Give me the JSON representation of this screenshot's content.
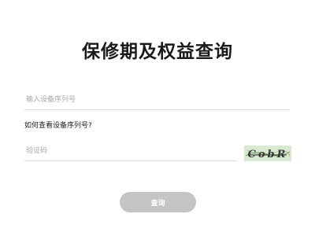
{
  "page": {
    "title": "保修期及权益查询"
  },
  "form": {
    "serial_placeholder": "输入设备序列号",
    "serial_value": "",
    "help_link": "如何查看设备序列号?",
    "code_placeholder": "验证码",
    "code_value": "",
    "captcha_text": "CobR",
    "submit_label": "查询"
  },
  "colors": {
    "button_bg": "#c4c4c4",
    "button_text": "#ffffff",
    "title_text": "#1a1a1a",
    "captcha_bg": "#d9ead3",
    "captcha_text": "#3a3a3a"
  }
}
